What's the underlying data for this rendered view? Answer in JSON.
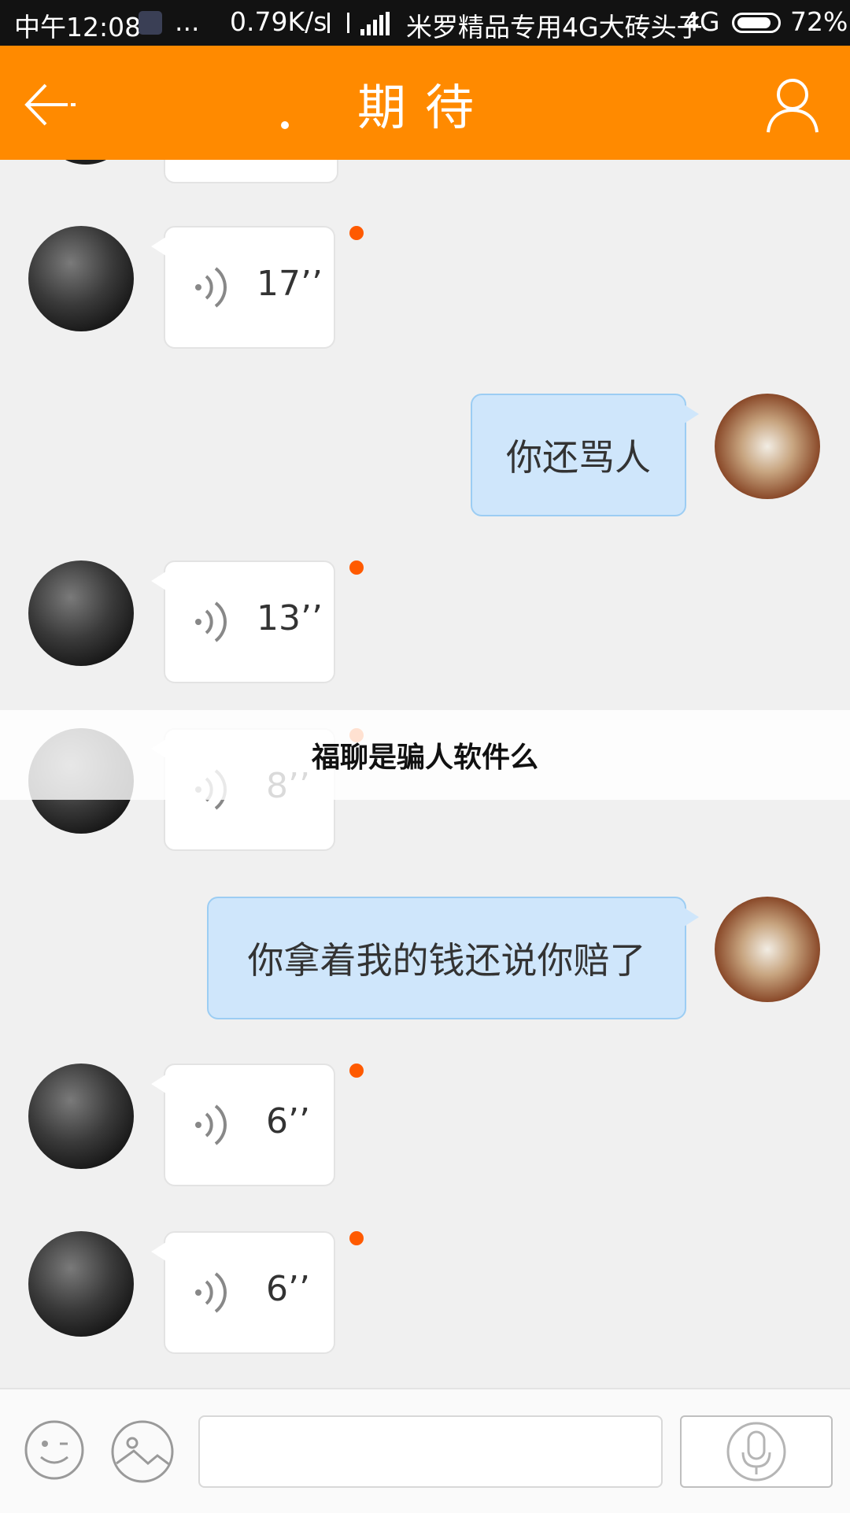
{
  "status_bar": {
    "time": "中午12:08",
    "notification_dots": "...",
    "speed": "0.79K/s",
    "carrier": "米罗精品专用4G大砖头子",
    "network": "4G",
    "battery": "72%"
  },
  "header": {
    "title": "期待"
  },
  "messages": [
    {
      "from": "them",
      "type": "voice",
      "duration": "17’’",
      "unread": true
    },
    {
      "from": "me",
      "type": "text",
      "text": "你还骂人"
    },
    {
      "from": "them",
      "type": "voice",
      "duration": "13’’",
      "unread": true
    },
    {
      "from": "them",
      "type": "voice",
      "duration": "8’’",
      "unread": true
    },
    {
      "from": "me",
      "type": "text",
      "text": "你拿着我的钱还说你赔了"
    },
    {
      "from": "them",
      "type": "voice",
      "duration": "6’’",
      "unread": true
    },
    {
      "from": "them",
      "type": "voice",
      "duration": "6’’",
      "unread": true
    }
  ],
  "watermark": {
    "text": "福聊是骗人软件么"
  },
  "input_bar": {
    "text_value": ""
  },
  "colors": {
    "accent": "#ff8a00",
    "unread": "#ff5a00",
    "sent_bubble": "#cfe6fb"
  }
}
